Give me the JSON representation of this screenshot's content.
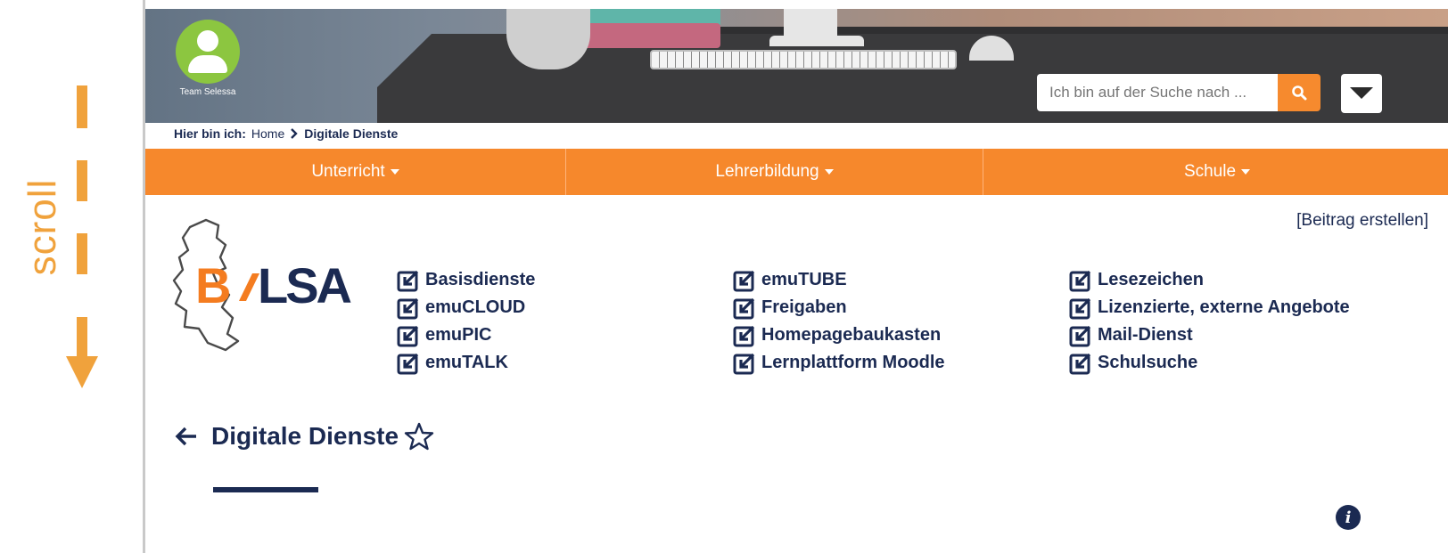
{
  "annotation": {
    "scroll_label": "scroll"
  },
  "header": {
    "user_name": "Team Selessa",
    "search_placeholder": "Ich bin auf der Suche nach ...",
    "search_icon": "search-icon",
    "menu_icon": "caret-down-icon"
  },
  "breadcrumb": {
    "label": "Hier bin ich:",
    "home": "Home",
    "current": "Digitale Dienste"
  },
  "nav": [
    {
      "label": "Unterricht"
    },
    {
      "label": "Lehrerbildung"
    },
    {
      "label": "Schule"
    }
  ],
  "actions": {
    "create_post": "[Beitrag erstellen]"
  },
  "logo": {
    "text_b": "B",
    "text_lsa": "LSA",
    "colors": {
      "orange": "#f47c20",
      "navy": "#1b2a52"
    }
  },
  "links": {
    "col1": [
      "Basisdienste",
      "emuCLOUD",
      "emuPIC",
      "emuTALK"
    ],
    "col2": [
      "emuTUBE",
      "Freigaben",
      "Homepagebaukasten",
      "Lernplattform Moodle"
    ],
    "col3": [
      "Lesezeichen",
      "Lizenzierte, externe Angebote",
      "Mail-Dienst",
      "Schulsuche"
    ]
  },
  "page": {
    "title": "Digitale Dienste",
    "back_icon": "arrow-left-icon",
    "favorite_icon": "star-outline-icon",
    "info_icon": "info-icon",
    "info_glyph": "i"
  },
  "colors": {
    "accent": "#f6882c",
    "text": "#1b2a52",
    "annotation": "#f0a23c"
  }
}
